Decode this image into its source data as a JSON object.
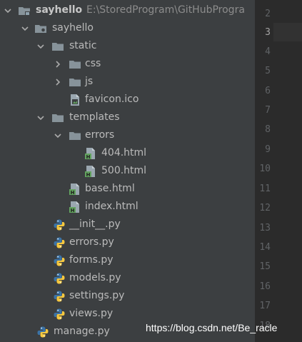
{
  "project": {
    "name": "sayhello",
    "path": "E:\\StoredProgram\\GitHubProgra"
  },
  "tree": {
    "pkg_sayhello": "sayhello",
    "static": "static",
    "css": "css",
    "js": "js",
    "favicon": "favicon.ico",
    "templates": "templates",
    "errors_dir": "errors",
    "html_404": "404.html",
    "html_500": "500.html",
    "base_html": "base.html",
    "index_html": "index.html",
    "init_py": "__init__.py",
    "errors_py": "errors.py",
    "forms_py": "forms.py",
    "models_py": "models.py",
    "settings_py": "settings.py",
    "views_py": "views.py",
    "manage_py": "manage.py"
  },
  "gutter": {
    "lines": [
      "2",
      "3",
      "4",
      "5",
      "6",
      "7",
      "8",
      "9",
      "10",
      "11",
      "12",
      "13",
      "14",
      "15",
      "16",
      "17",
      "18"
    ],
    "current_line": "3"
  },
  "watermark": "https://blog.csdn.net/Be_racle",
  "icons": {
    "expand": "chevron-down-icon",
    "collapse": "chevron-right-icon",
    "folder": "folder-icon",
    "python": "python-file-icon",
    "html": "html-file-icon",
    "ico": "image-file-icon"
  },
  "colors": {
    "tree_bg": "#3c3f41",
    "editor_bg": "#2b2b2b",
    "text": "#bbbbbb",
    "folder": "#87939a",
    "html_icon": "#6a9a4e",
    "python_blue": "#3b73a6",
    "python_yellow": "#f6c83f"
  }
}
